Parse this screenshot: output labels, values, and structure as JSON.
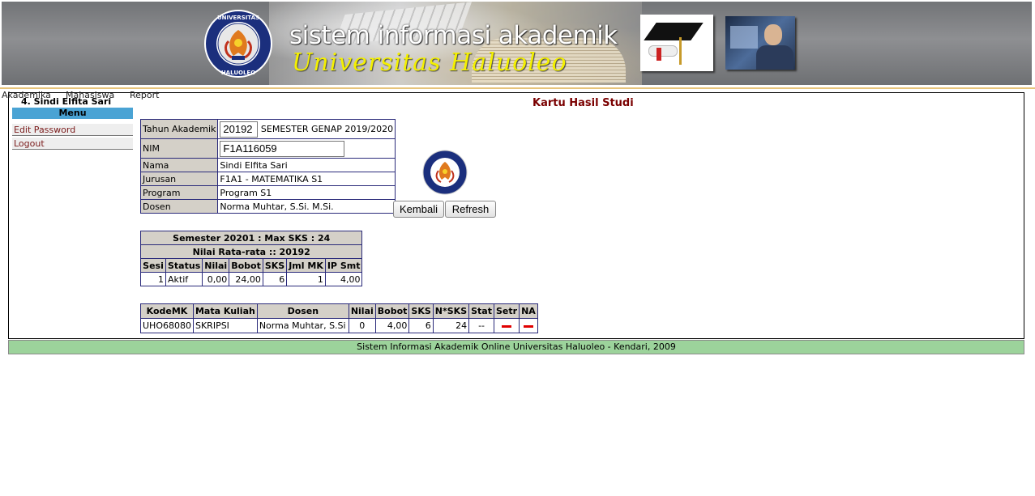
{
  "header": {
    "title": "sistem informasi akademik",
    "subtitle": "Universitas Haluoleo",
    "logo_text_top": "UNIVERSITAS",
    "logo_text_bottom": "HALUOLEO"
  },
  "topnav": [
    "Akademika",
    "Mahasiswa",
    "Report"
  ],
  "sidebar": {
    "user": "4. Sindi Elfita Sari",
    "menu_title": "Menu",
    "items": [
      {
        "label": "Edit Password"
      },
      {
        "label": "Logout"
      }
    ]
  },
  "page_title": "Kartu Hasil Studi",
  "student": {
    "labels": {
      "tahun": "Tahun Akademik",
      "nim": "NIM",
      "nama": "Nama",
      "jurusan": "Jurusan",
      "program": "Program",
      "dosen": "Dosen"
    },
    "tahun_value": "20192",
    "semester_text": "SEMESTER GENAP 2019/2020",
    "nim_value": "F1A116059",
    "nama": "Sindi Elfita Sari",
    "jurusan": "F1A1 - MATEMATIKA S1",
    "program": "Program S1",
    "dosen": "Norma Muhtar, S.Si. M.Si."
  },
  "buttons": {
    "kembali": "Kembali",
    "refresh": "Refresh"
  },
  "summary": {
    "semester_line": "Semester 20201 : Max SKS : 24",
    "average_line": "Nilai Rata-rata :: 20192",
    "headers": [
      "Sesi",
      "Status",
      "Nilai",
      "Bobot",
      "SKS",
      "Jml MK",
      "IP Smt"
    ],
    "row": {
      "sesi": "1",
      "status": "Aktif",
      "nilai": "0,00",
      "bobot": "24,00",
      "sks": "6",
      "jml_mk": "1",
      "ip_smt": "4,00"
    }
  },
  "courses": {
    "headers": [
      "KodeMK",
      "Mata Kuliah",
      "Dosen",
      "Nilai",
      "Bobot",
      "SKS",
      "N*SKS",
      "Stat",
      "Setr",
      "NA"
    ],
    "rows": [
      {
        "kode": "UHO68080",
        "mata_kuliah": "SKRIPSI",
        "dosen": "Norma Muhtar, S.Si",
        "nilai": "0",
        "bobot": "4,00",
        "sks": "6",
        "n_sks": "24",
        "stat": "--"
      }
    ]
  },
  "footer": "Sistem Informasi Akademik Online Universitas Haluoleo - Kendari, 2009",
  "colors": {
    "menu_header": "#4aa3d4",
    "link": "#7a1a1a",
    "title": "#7a0000",
    "table_header": "#d4d0c8",
    "footer_bg": "#9cd39b",
    "action_dash": "#e00000"
  }
}
